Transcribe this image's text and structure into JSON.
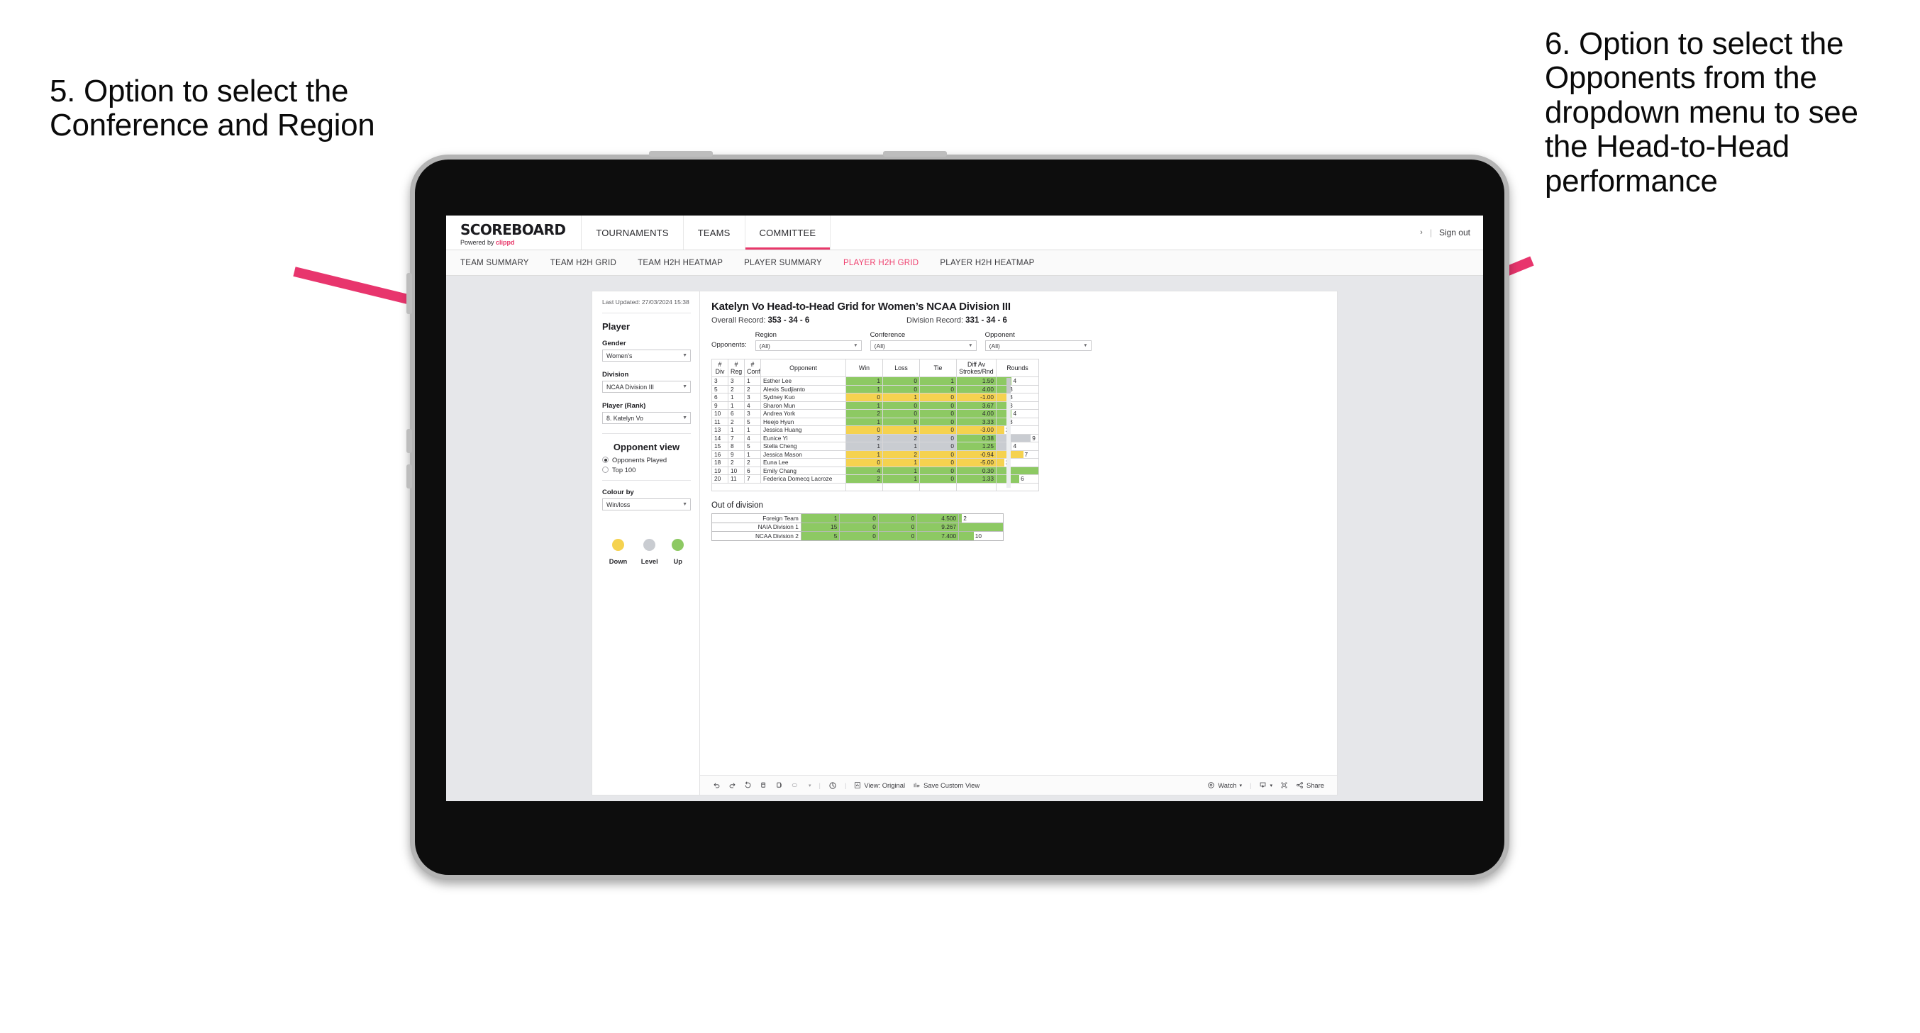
{
  "annotations": {
    "left": "5. Option to select the Conference and Region",
    "right": "6. Option to select the Opponents from the dropdown menu to see the Head-to-Head performance",
    "arrow_color": "#E8356D"
  },
  "app": {
    "brand_title": "SCOREBOARD",
    "brand_sub_prefix": "Powered by ",
    "brand_sub_accent": "clippd",
    "accent_color": "#E8386A",
    "top_nav": [
      {
        "label": "TOURNAMENTS",
        "active": false
      },
      {
        "label": "TEAMS",
        "active": false
      },
      {
        "label": "COMMITTEE",
        "active": true
      }
    ],
    "header_right": {
      "chevron": "›",
      "separator": "|",
      "sign_out": "Sign out"
    },
    "sub_nav": [
      {
        "label": "TEAM SUMMARY",
        "active": false
      },
      {
        "label": "TEAM H2H GRID",
        "active": false
      },
      {
        "label": "TEAM H2H HEATMAP",
        "active": false
      },
      {
        "label": "PLAYER SUMMARY",
        "active": false
      },
      {
        "label": "PLAYER H2H GRID",
        "active": true
      },
      {
        "label": "PLAYER H2H HEATMAP",
        "active": false
      }
    ]
  },
  "sidebar": {
    "last_updated": "Last Updated: 27/03/2024 15:38",
    "section_player": "Player",
    "gender": {
      "label": "Gender",
      "value": "Women’s"
    },
    "division": {
      "label": "Division",
      "value": "NCAA Division III"
    },
    "player_rank": {
      "label": "Player (Rank)",
      "value": "8. Katelyn Vo"
    },
    "opponent_view": {
      "title": "Opponent view",
      "options": [
        {
          "label": "Opponents Played",
          "selected": true
        },
        {
          "label": "Top 100",
          "selected": false
        }
      ]
    },
    "colour_by": {
      "label": "Colour by",
      "value": "Win/loss"
    },
    "legend": [
      {
        "label": "Down",
        "color": "#F5D24F"
      },
      {
        "label": "Level",
        "color": "#C9CCD1"
      },
      {
        "label": "Up",
        "color": "#8DC963"
      }
    ]
  },
  "main": {
    "title": "Katelyn Vo Head-to-Head Grid for Women’s NCAA Division III",
    "overall_record_label": "Overall Record: ",
    "overall_record_value": "353 - 34 - 6",
    "division_record_label": "Division Record: ",
    "division_record_value": "331 - 34 - 6",
    "opponents_label": "Opponents:",
    "filters": [
      {
        "label": "Region",
        "value": "(All)"
      },
      {
        "label": "Conference",
        "value": "(All)"
      },
      {
        "label": "Opponent",
        "value": "(All)"
      }
    ],
    "out_of_division_title": "Out of division"
  },
  "chart_data": {
    "type": "table",
    "title": "Katelyn Vo Head-to-Head Grid for Women’s NCAA Division III",
    "columns": [
      "# Div",
      "# Reg",
      "# Conf",
      "Opponent",
      "Win",
      "Loss",
      "Tie",
      "Diff Av Strokes/Rnd",
      "Rounds"
    ],
    "column_headers_two_line": [
      {
        "top": "#",
        "bottom": "Div"
      },
      {
        "top": "#",
        "bottom": "Reg"
      },
      {
        "top": "#",
        "bottom": "Conf"
      },
      {
        "top": "",
        "bottom": "Opponent"
      },
      {
        "top": "",
        "bottom": "Win"
      },
      {
        "top": "",
        "bottom": "Loss"
      },
      {
        "top": "",
        "bottom": "Tie"
      },
      {
        "top": "Diff Av",
        "bottom": "Strokes/Rnd"
      },
      {
        "top": "",
        "bottom": "Rounds"
      }
    ],
    "rounds_max": 11,
    "colors": {
      "up": "#8DC963",
      "down": "#F5D24F",
      "level": "#C9CCD1"
    },
    "rows": [
      {
        "div": "3",
        "reg": "3",
        "conf": "1",
        "opponent": "Esther Lee",
        "win": "1",
        "loss": "0",
        "tie": "1",
        "diff": "1.50",
        "rounds": "4",
        "state": "up"
      },
      {
        "div": "5",
        "reg": "2",
        "conf": "2",
        "opponent": "Alexis Sudjianto",
        "win": "1",
        "loss": "0",
        "tie": "0",
        "diff": "4.00",
        "rounds": "3",
        "state": "up"
      },
      {
        "div": "6",
        "reg": "1",
        "conf": "3",
        "opponent": "Sydney Kuo",
        "win": "0",
        "loss": "1",
        "tie": "0",
        "diff": "-1.00",
        "rounds": "3",
        "state": "down"
      },
      {
        "div": "9",
        "reg": "1",
        "conf": "4",
        "opponent": "Sharon Mun",
        "win": "1",
        "loss": "0",
        "tie": "0",
        "diff": "3.67",
        "rounds": "3",
        "state": "up"
      },
      {
        "div": "10",
        "reg": "6",
        "conf": "3",
        "opponent": "Andrea York",
        "win": "2",
        "loss": "0",
        "tie": "0",
        "diff": "4.00",
        "rounds": "4",
        "state": "up"
      },
      {
        "div": "11",
        "reg": "2",
        "conf": "5",
        "opponent": "Heejo Hyun",
        "win": "1",
        "loss": "0",
        "tie": "0",
        "diff": "3.33",
        "rounds": "3",
        "state": "up"
      },
      {
        "div": "13",
        "reg": "1",
        "conf": "1",
        "opponent": "Jessica Huang",
        "win": "0",
        "loss": "1",
        "tie": "0",
        "diff": "-3.00",
        "rounds": "2",
        "state": "down"
      },
      {
        "div": "14",
        "reg": "7",
        "conf": "4",
        "opponent": "Eunice Yi",
        "win": "2",
        "loss": "2",
        "tie": "0",
        "diff": "0.38",
        "rounds": "9",
        "state": "level",
        "diff_state": "up"
      },
      {
        "div": "15",
        "reg": "8",
        "conf": "5",
        "opponent": "Stella Cheng",
        "win": "1",
        "loss": "1",
        "tie": "0",
        "diff": "1.25",
        "rounds": "4",
        "state": "level",
        "diff_state": "up"
      },
      {
        "div": "16",
        "reg": "9",
        "conf": "1",
        "opponent": "Jessica Mason",
        "win": "1",
        "loss": "2",
        "tie": "0",
        "diff": "-0.94",
        "rounds": "7",
        "state": "down"
      },
      {
        "div": "18",
        "reg": "2",
        "conf": "2",
        "opponent": "Euna Lee",
        "win": "0",
        "loss": "1",
        "tie": "0",
        "diff": "-5.00",
        "rounds": "2",
        "state": "down"
      },
      {
        "div": "19",
        "reg": "10",
        "conf": "6",
        "opponent": "Emily Chang",
        "win": "4",
        "loss": "1",
        "tie": "0",
        "diff": "0.30",
        "rounds": "11",
        "state": "up"
      },
      {
        "div": "20",
        "reg": "11",
        "conf": "7",
        "opponent": "Federica Domecq Lacroze",
        "win": "2",
        "loss": "1",
        "tie": "0",
        "diff": "1.33",
        "rounds": "6",
        "state": "up"
      }
    ],
    "out_of_division": {
      "title": "Out of division",
      "rounds_max": 30,
      "rows": [
        {
          "name": "Foreign Team",
          "win": "1",
          "loss": "0",
          "tie": "0",
          "diff": "4.500",
          "rounds": "2",
          "state": "up"
        },
        {
          "name": "NAIA Division 1",
          "win": "15",
          "loss": "0",
          "tie": "0",
          "diff": "9.267",
          "rounds": "30",
          "state": "up"
        },
        {
          "name": "NCAA Division 2",
          "win": "5",
          "loss": "0",
          "tie": "0",
          "diff": "7.400",
          "rounds": "10",
          "state": "up"
        }
      ]
    }
  },
  "toolbar": {
    "view_label": "View: Original",
    "save_custom_view_label": "Save Custom View",
    "watch_label": "Watch",
    "share_label": "Share",
    "separator": "|",
    "caret": "▾"
  }
}
